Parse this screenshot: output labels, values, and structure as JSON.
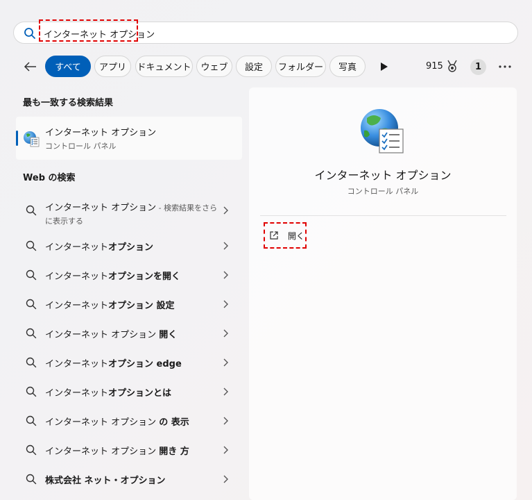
{
  "search": {
    "query": "インターネット オプション"
  },
  "toolbar": {
    "chips": {
      "all": "すべて",
      "apps": "アプリ",
      "documents": "ドキュメント",
      "web": "ウェブ",
      "settings": "設定",
      "folders": "フォルダー",
      "photos": "写真"
    },
    "points": "915",
    "badge_count": "1"
  },
  "best_match": {
    "heading": "最も一致する検索結果",
    "title": "インターネット オプション",
    "subtitle": "コントロール パネル"
  },
  "web_search": {
    "heading": "Web の検索",
    "items": [
      {
        "text": "インターネット オプション",
        "suffix": " - 検索結果をさら",
        "line2": "に表示する"
      },
      {
        "pre": "インターネット",
        "bold": "オプション"
      },
      {
        "pre": "インターネット",
        "bold": "オプションを開く"
      },
      {
        "pre": "インターネット",
        "bold": "オプション 設定"
      },
      {
        "pre": "インターネット オプション ",
        "bold": "開く"
      },
      {
        "pre": "インターネット",
        "bold": "オプション edge"
      },
      {
        "pre": "インターネット",
        "bold": "オプションとは"
      },
      {
        "pre": "インターネット オプション ",
        "bold": "の 表示"
      },
      {
        "pre": "インターネット オプション ",
        "bold": "開き 方"
      },
      {
        "pre": "",
        "bold": "株式会社 ネット・オプション"
      }
    ]
  },
  "detail": {
    "title": "インターネット オプション",
    "subtitle": "コントロール パネル",
    "open_label": "開く"
  },
  "colors": {
    "accent": "#005fb8",
    "highlight": "#e00000"
  }
}
